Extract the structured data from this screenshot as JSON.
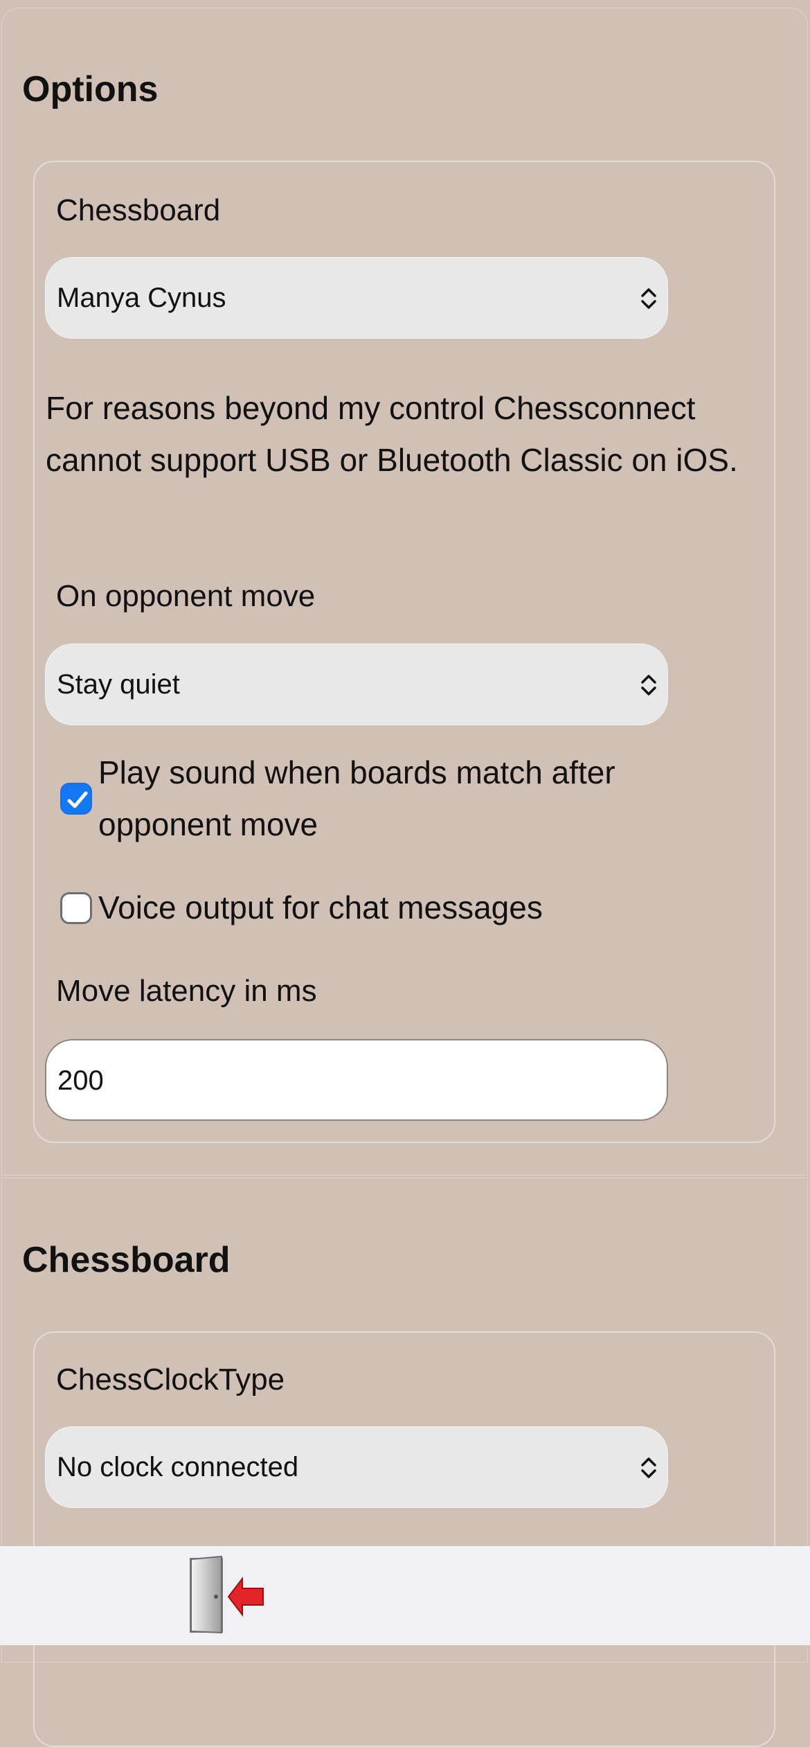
{
  "options_section": {
    "title": "Options",
    "chessboard_label": "Chessboard",
    "chessboard_select": {
      "selected": "Manya Cynus"
    },
    "note": "For reasons beyond my control Chessconnect cannot support USB or Bluetooth Classic on iOS.",
    "opponent_move_label": "On opponent move",
    "opponent_move_select": {
      "selected": "Stay quiet"
    },
    "play_sound_checkbox": {
      "label": "Play sound when boards match after opponent move",
      "checked": true
    },
    "voice_output_checkbox": {
      "label": "Voice output for chat messages",
      "checked": false
    },
    "latency_label": "Move latency in ms",
    "latency_input": {
      "value": "200"
    }
  },
  "chessboard_section": {
    "title": "Chessboard",
    "clock_type_label": "ChessClockType",
    "clock_type_select": {
      "selected": "No clock connected"
    }
  },
  "bottom_bar": {
    "exit_icon": "exit-door-icon"
  },
  "colors": {
    "background": "#d1c0b6",
    "select_bg": "#e8e8e8",
    "checkbox_accent": "#1378f2",
    "bottom_bar_bg": "#f1f0f5",
    "exit_arrow": "#e3242b"
  }
}
